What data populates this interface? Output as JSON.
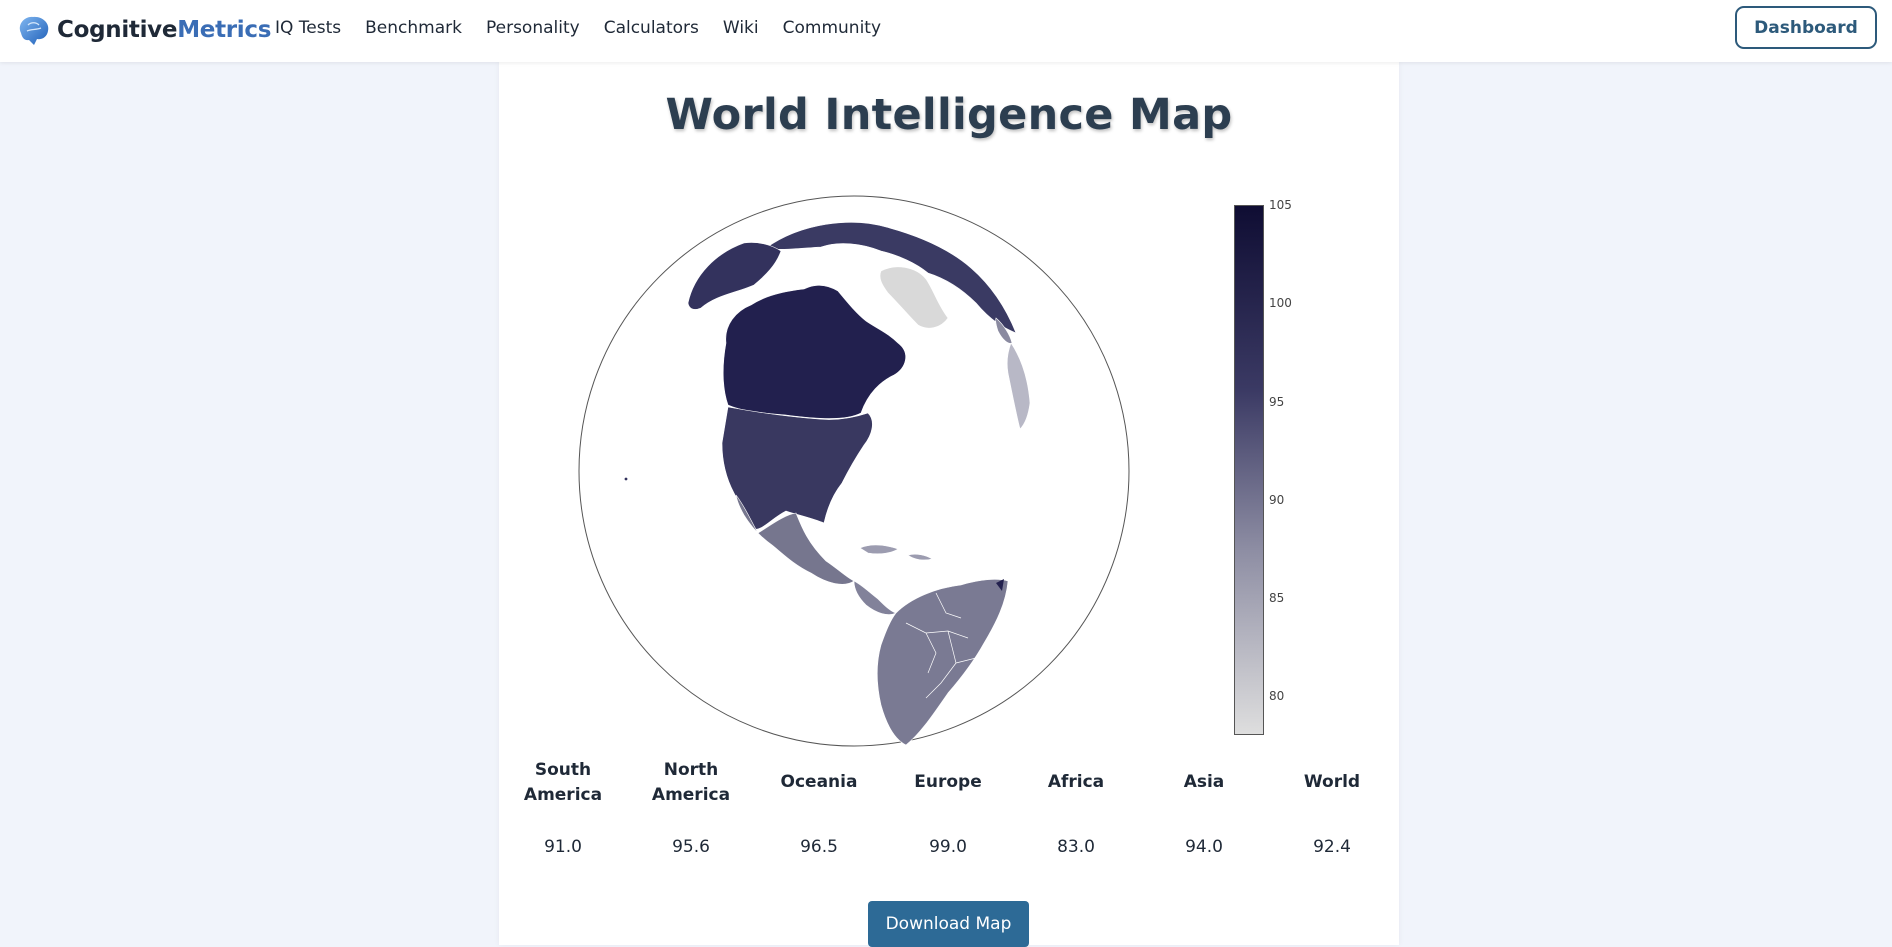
{
  "navbar": {
    "logo_part1": "Cognitive",
    "logo_part2": "Metrics",
    "links": [
      "IQ Tests",
      "Benchmark",
      "Personality",
      "Calculators",
      "Wiki",
      "Community"
    ],
    "dashboard_label": "Dashboard"
  },
  "page": {
    "title": "World Intelligence Map"
  },
  "colorbar": {
    "ticks": [
      "105",
      "100",
      "95",
      "90",
      "85",
      "80"
    ],
    "color_high": "#0f0d33",
    "color_low": "#dedede"
  },
  "regions": [
    {
      "name_line1": "South",
      "name_line2": "America",
      "value": "91.0"
    },
    {
      "name_line1": "North",
      "name_line2": "America",
      "value": "95.6"
    },
    {
      "name_line1": "Oceania",
      "name_line2": "",
      "value": "96.5"
    },
    {
      "name_line1": "Europe",
      "name_line2": "",
      "value": "99.0"
    },
    {
      "name_line1": "Africa",
      "name_line2": "",
      "value": "83.0"
    },
    {
      "name_line1": "Asia",
      "name_line2": "",
      "value": "94.0"
    },
    {
      "name_line1": "World",
      "name_line2": "",
      "value": "92.4"
    }
  ],
  "download_label": "Download Map"
}
